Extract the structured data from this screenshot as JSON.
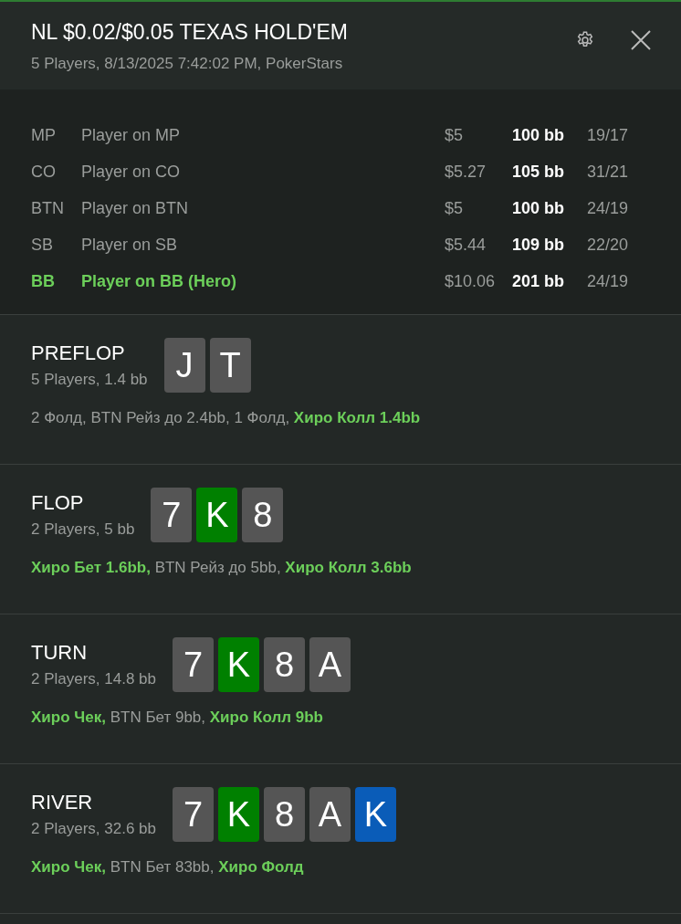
{
  "header": {
    "title": "NL $0.02/$0.05 TEXAS HOLD'EM",
    "subtitle": "5 Players, 8/13/2025 7:42:02 PM, PokerStars"
  },
  "players": [
    {
      "position": "MP",
      "name": "Player on MP",
      "stack": "$5",
      "bb": "100 bb",
      "stats": "19/17",
      "hero": false
    },
    {
      "position": "CO",
      "name": "Player on CO",
      "stack": "$5.27",
      "bb": "105 bb",
      "stats": "31/21",
      "hero": false
    },
    {
      "position": "BTN",
      "name": "Player on BTN",
      "stack": "$5",
      "bb": "100 bb",
      "stats": "24/19",
      "hero": false
    },
    {
      "position": "SB",
      "name": "Player on SB",
      "stack": "$5.44",
      "bb": "109 bb",
      "stats": "22/20",
      "hero": false
    },
    {
      "position": "BB",
      "name": "Player on BB (Hero)",
      "stack": "$10.06",
      "bb": "201 bb",
      "stats": "24/19",
      "hero": true
    }
  ],
  "streets": [
    {
      "name": "PREFLOP",
      "info": "5 Players, 1.4 bb",
      "cards": [
        {
          "rank": "J",
          "color": "#555555"
        },
        {
          "rank": "T",
          "color": "#555555"
        }
      ],
      "actions": [
        {
          "text": "2 Фолд,",
          "hero": false
        },
        {
          "text": "BTN Рейз до 2.4bb,",
          "hero": false
        },
        {
          "text": "1 Фолд,",
          "hero": false
        },
        {
          "text": "Хиро Колл 1.4bb",
          "hero": true
        }
      ]
    },
    {
      "name": "FLOP",
      "info": "2 Players, 5 bb",
      "cards": [
        {
          "rank": "7",
          "color": "#555555"
        },
        {
          "rank": "K",
          "color": "#008000"
        },
        {
          "rank": "8",
          "color": "#555555"
        }
      ],
      "actions": [
        {
          "text": "Хиро Бет 1.6bb,",
          "hero": true
        },
        {
          "text": "BTN Рейз до 5bb,",
          "hero": false
        },
        {
          "text": "Хиро Колл 3.6bb",
          "hero": true
        }
      ]
    },
    {
      "name": "TURN",
      "info": "2 Players, 14.8 bb",
      "cards": [
        {
          "rank": "7",
          "color": "#555555"
        },
        {
          "rank": "K",
          "color": "#008000"
        },
        {
          "rank": "8",
          "color": "#555555"
        },
        {
          "rank": "A",
          "color": "#555555"
        }
      ],
      "actions": [
        {
          "text": "Хиро Чек,",
          "hero": true
        },
        {
          "text": "BTN Бет 9bb,",
          "hero": false
        },
        {
          "text": "Хиро Колл 9bb",
          "hero": true
        }
      ]
    },
    {
      "name": "RIVER",
      "info": "2 Players, 32.6 bb",
      "cards": [
        {
          "rank": "7",
          "color": "#555555"
        },
        {
          "rank": "K",
          "color": "#008000"
        },
        {
          "rank": "8",
          "color": "#555555"
        },
        {
          "rank": "A",
          "color": "#555555"
        },
        {
          "rank": "K",
          "color": "#0a5cb8"
        }
      ],
      "actions": [
        {
          "text": "Хиро Чек,",
          "hero": true
        },
        {
          "text": "BTN Бет 83bb,",
          "hero": false
        },
        {
          "text": "Хиро Фолд",
          "hero": true
        }
      ]
    }
  ]
}
